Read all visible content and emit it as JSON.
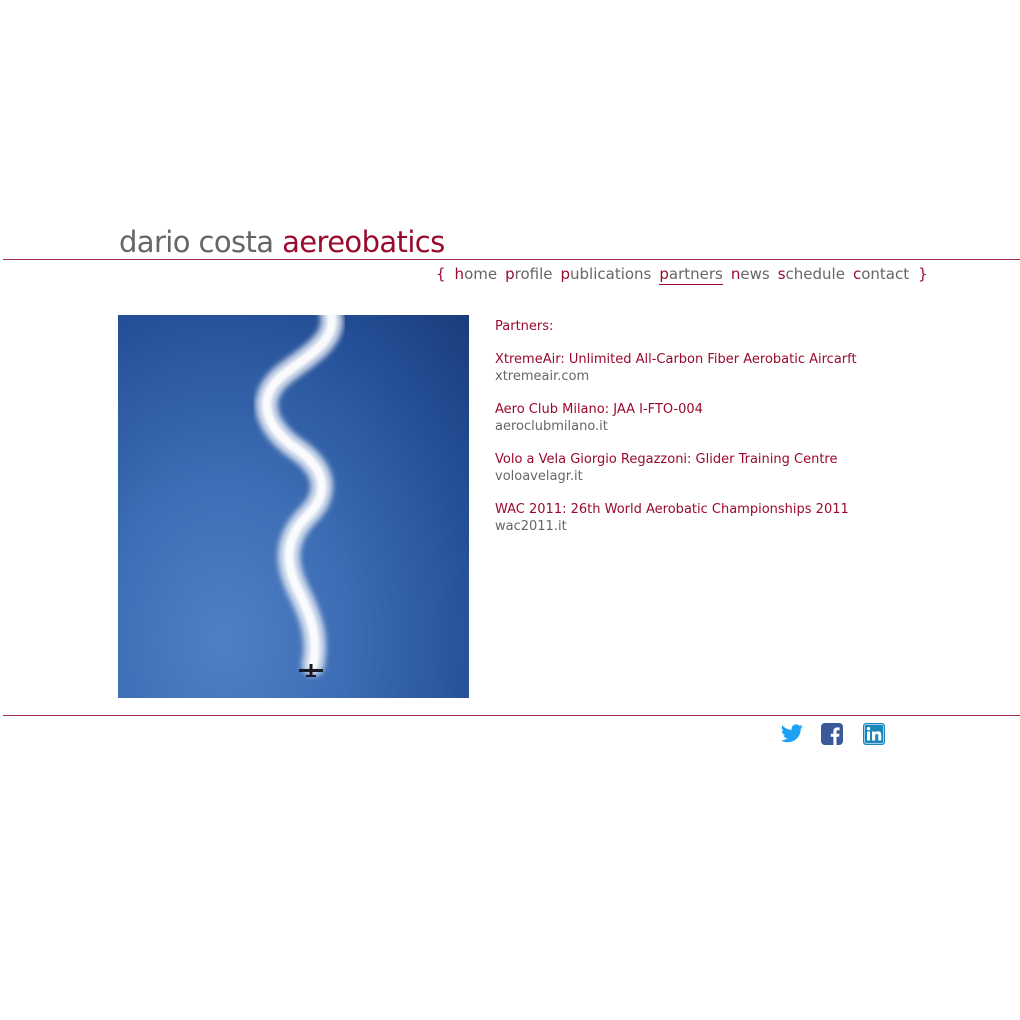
{
  "header": {
    "site_name": "dario costa",
    "site_brand": "aereobatics"
  },
  "nav": {
    "open_brace": "{",
    "close_brace": "}",
    "items": [
      {
        "first": "h",
        "rest": "ome"
      },
      {
        "first": "p",
        "rest": "rofile"
      },
      {
        "first": "p",
        "rest": "ublications"
      },
      {
        "first": "p",
        "rest": "artners",
        "active": true
      },
      {
        "first": "n",
        "rest": "ews"
      },
      {
        "first": "s",
        "rest": "chedule"
      },
      {
        "first": "c",
        "rest": "ontact"
      }
    ]
  },
  "main": {
    "heading": "Partners:",
    "partners": [
      {
        "title": "XtremeAir: Unlimited All-Carbon Fiber Aerobatic Aircarft",
        "link": "xtremeair.com"
      },
      {
        "title": "Aero Club Milano: JAA I-FTO-004",
        "link": "aeroclubmilano.it"
      },
      {
        "title": "Volo a Vela Giorgio Regazzoni: Glider Training Centre",
        "link": "voloavelagr.it"
      },
      {
        "title": "WAC 2011: 26th World Aerobatic Championships 2011",
        "link": "wac2011.it"
      }
    ]
  },
  "footer": {
    "social_icons": [
      "twitter-icon",
      "facebook-icon",
      "linkedin-icon"
    ]
  },
  "colors": {
    "accent": "#9a0a2c",
    "text_gray": "#666666",
    "sky_blue": "#3d6db4",
    "twitter": "#1da1f2",
    "facebook": "#3b5998",
    "linkedin": "#1b86bc"
  }
}
